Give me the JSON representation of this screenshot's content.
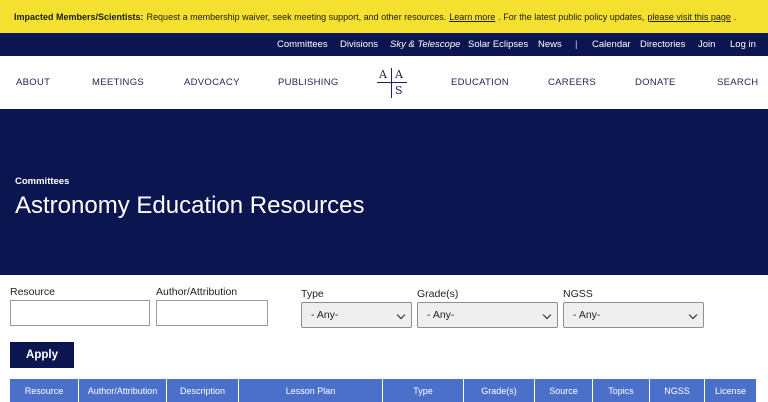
{
  "alert": {
    "bold": "Impacted Members/Scientists:",
    "text": "Request a membership waiver, seek meeting support, and other resources.",
    "link1": "Learn more",
    "text2": ". For the latest public policy updates,",
    "link2": "please visit this page",
    "end": "."
  },
  "topnav": {
    "committees": "Committees",
    "divisions": "Divisions",
    "sky": "Sky & Telescope",
    "solar": "Solar Eclipses",
    "news": "News",
    "separator": "|",
    "calendar": "Calendar",
    "directories": "Directories",
    "join": "Join",
    "login": "Log in"
  },
  "mainnav": {
    "about": "ABOUT",
    "meetings": "MEETINGS",
    "advocacy": "ADVOCACY",
    "publishing": "PUBLISHING",
    "education": "EDUCATION",
    "careers": "CAREERS",
    "donate": "DONATE",
    "search": "SEARCH",
    "logo": [
      "A",
      "A",
      "S"
    ]
  },
  "hero": {
    "breadcrumb": "Committees",
    "title": "Astronomy Education Resources"
  },
  "filters": {
    "resource_label": "Resource",
    "resource_value": "",
    "author_label": "Author/Attribution",
    "author_value": "",
    "type_label": "Type",
    "type_value": "- Any-",
    "grades_label": "Grade(s)",
    "grades_value": "- Any-",
    "ngss_label": "NGSS",
    "ngss_value": "- Any-",
    "apply": "Apply"
  },
  "table": {
    "headers": [
      "Resource",
      "Author/Attribution",
      "Description",
      "Lesson Plan",
      "Type",
      "Grade(s)",
      "Source",
      "Topics",
      "NGSS",
      "License"
    ]
  },
  "colors": {
    "alert_bg": "#f4e12f",
    "navy": "#0b1550",
    "table_header": "#4a70c9"
  }
}
